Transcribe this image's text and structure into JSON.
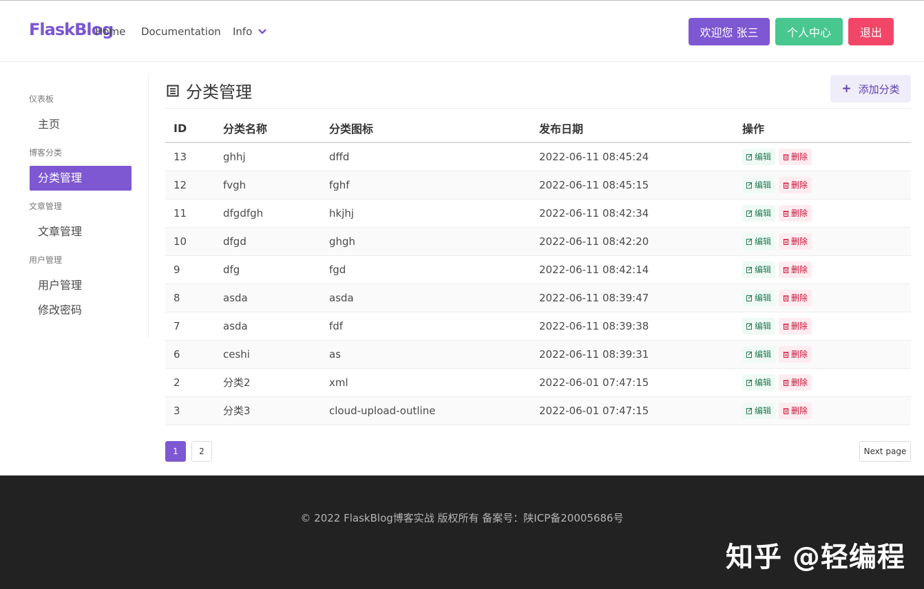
{
  "header": {
    "logo": "FlaskBlog",
    "nav": {
      "home": "Home",
      "documentation": "Documentation",
      "info": "Info"
    },
    "buttons": {
      "welcome": "欢迎您 张三",
      "profile": "个人中心",
      "logout": "退出"
    },
    "colors": {
      "primary": "#7e57d2",
      "success": "#48c78e",
      "danger": "#f14668"
    }
  },
  "sidebar": {
    "sections": [
      {
        "label": "仪表板",
        "items": [
          "主页"
        ]
      },
      {
        "label": "博客分类",
        "items": [
          "分类管理"
        ]
      },
      {
        "label": "文章管理",
        "items": [
          "文章管理"
        ]
      },
      {
        "label": "用户管理",
        "items": [
          "用户管理",
          "修改密码"
        ]
      }
    ],
    "active": "分类管理"
  },
  "main": {
    "title": "分类管理",
    "add_button": "添加分类",
    "table": {
      "headers": [
        "ID",
        "分类名称",
        "分类图标",
        "发布日期",
        "操作"
      ],
      "rows": [
        [
          "13",
          "ghhj",
          "dffd",
          "2022-06-11 08:45:24"
        ],
        [
          "12",
          "fvgh",
          "fghf",
          "2022-06-11 08:45:15"
        ],
        [
          "11",
          "dfgdfgh",
          "hkjhj",
          "2022-06-11 08:42:34"
        ],
        [
          "10",
          "dfgd",
          "ghgh",
          "2022-06-11 08:42:20"
        ],
        [
          "9",
          "dfg",
          "fgd",
          "2022-06-11 08:42:14"
        ],
        [
          "8",
          "asda",
          "asda",
          "2022-06-11 08:39:47"
        ],
        [
          "7",
          "asda",
          "fdf",
          "2022-06-11 08:39:38"
        ],
        [
          "6",
          "ceshi",
          "as",
          "2022-06-11 08:39:31"
        ],
        [
          "2",
          "分类2",
          "xml",
          "2022-06-01 07:47:15"
        ],
        [
          "3",
          "分类3",
          "cloud-upload-outline",
          "2022-06-01 07:47:15"
        ]
      ],
      "edit_label": "编辑",
      "delete_label": "删除"
    },
    "pagination": {
      "pages": [
        "1",
        "2"
      ],
      "current": "1",
      "next": "Next page"
    }
  },
  "footer": {
    "text": "© 2022 FlaskBlog博客实战 版权所有 备案号：陕ICP备20005686号",
    "watermark": "知乎 @轻编程"
  }
}
